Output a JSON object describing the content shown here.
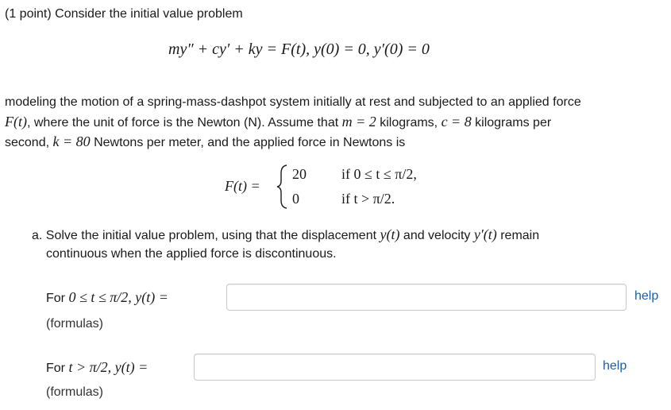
{
  "problem": {
    "header": "(1 point) Consider the initial value problem",
    "equation": "my″ + cy′ + ky = F(t),   y(0) = 0,   y′(0) = 0",
    "para_line1": "modeling the motion of a spring-mass-dashpot system initially at rest and subjected to an applied force",
    "para_line2_a": "F(t)",
    "para_line2_b": ", where the unit of force is the Newton (N). Assume that ",
    "para_line2_c": "m = 2",
    "para_line2_d": " kilograms, ",
    "para_line2_e": "c = 8",
    "para_line2_f": " kilograms per",
    "para_line3_a": "second, ",
    "para_line3_b": "k = 80",
    "para_line3_c": " Newtons per meter, and the applied force in Newtons is",
    "piecewise": {
      "lhs": "F(t) =",
      "val1": "20",
      "cond1": "if 0 ≤ t ≤ π/2,",
      "val2": "0",
      "cond2": "if t > π/2."
    },
    "part_a_line1_a": "a. Solve the initial value problem, using that the displacement ",
    "part_a_line1_b": "y(t)",
    "part_a_line1_c": " and velocity ",
    "part_a_line1_d": "y′(t)",
    "part_a_line1_e": " remain",
    "part_a_line2": "continuous when the applied force is discontinuous."
  },
  "answers": [
    {
      "prefix": "For ",
      "condition": "0 ≤ t ≤ π/2,  y(t) =",
      "value": "",
      "help": "help",
      "formulas": "(formulas)"
    },
    {
      "prefix": "For ",
      "condition": "t > π/2,  y(t) =",
      "value": "",
      "help": "help",
      "formulas": "(formulas)"
    }
  ]
}
